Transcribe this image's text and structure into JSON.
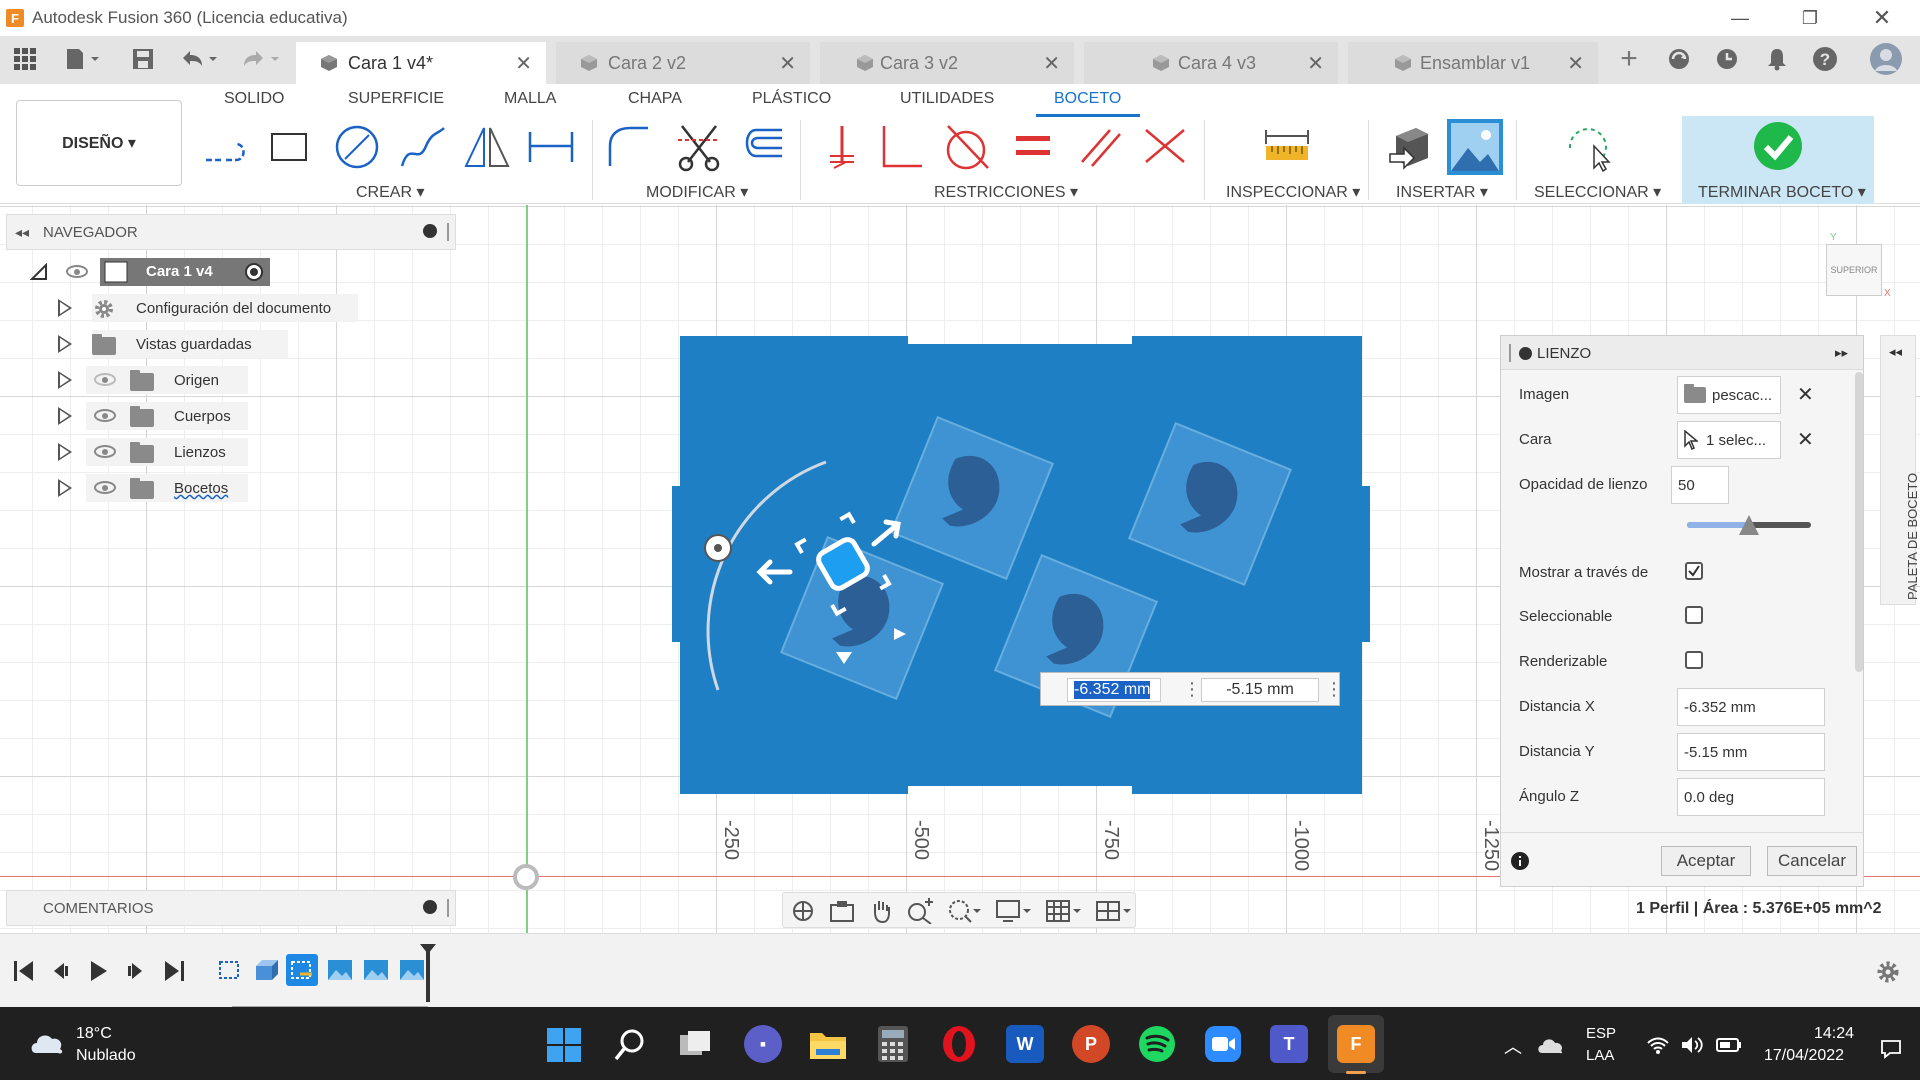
{
  "window": {
    "title": "Autodesk Fusion 360 (Licencia educativa)",
    "logo_letter": "F"
  },
  "tabs": [
    {
      "label": "Cara 1 v4*",
      "active": true
    },
    {
      "label": "Cara 2 v2",
      "active": false
    },
    {
      "label": "Cara 3 v2",
      "active": false
    },
    {
      "label": "Cara 4 v3",
      "active": false
    },
    {
      "label": "Ensamblar v1",
      "active": false
    }
  ],
  "workspace_tabs": [
    "SOLIDO",
    "SUPERFICIE",
    "MALLA",
    "CHAPA",
    "PLÁSTICO",
    "UTILIDADES",
    "BOCETO"
  ],
  "active_workspace_tab": "BOCETO",
  "design_button": "DISEÑO ▾",
  "ribbon_groups": {
    "crear": "CREAR ▾",
    "modificar": "MODIFICAR ▾",
    "restricciones": "RESTRICCIONES ▾",
    "inspeccionar": "INSPECCIONAR ▾",
    "insertar": "INSERTAR ▾",
    "seleccionar": "SELECCIONAR ▾",
    "terminar": "TERMINAR BOCETO ▾"
  },
  "navigator": {
    "title": "NAVEGADOR",
    "root": "Cara 1 v4",
    "items": [
      {
        "label": "Configuración del documento",
        "icon": "gear-icon"
      },
      {
        "label": "Vistas guardadas",
        "icon": "folder-icon"
      },
      {
        "label": "Origen",
        "icon": "folder-icon"
      },
      {
        "label": "Cuerpos",
        "icon": "folder-icon"
      },
      {
        "label": "Lienzos",
        "icon": "folder-icon"
      },
      {
        "label": "Bocetos",
        "icon": "folder-icon"
      }
    ]
  },
  "comments_label": "COMENTARIOS",
  "view_cube_label": "SUPERIOR",
  "ruler_labels": [
    "-250",
    "-500",
    "-750",
    "-1000",
    "-1250"
  ],
  "coordinate_input": {
    "x": "-6.352 mm",
    "y": "-5.15 mm"
  },
  "dialog": {
    "title": "LIENZO",
    "image_label": "Imagen",
    "image_value": "pescac...",
    "face_label": "Cara",
    "face_value": "1 selec...",
    "opacity_label": "Opacidad de lienzo",
    "opacity_value": "50",
    "opacity_level_percent": 50,
    "show_through_label": "Mostrar a través de",
    "show_through_checked": true,
    "selectable_label": "Seleccionable",
    "selectable_checked": false,
    "renderable_label": "Renderizable",
    "renderable_checked": false,
    "dist_x_label": "Distancia X",
    "dist_x_value": "-6.352 mm",
    "dist_y_label": "Distancia Y",
    "dist_y_value": "-5.15 mm",
    "angle_label": "Ángulo Z",
    "angle_value": "0.0 deg",
    "ok_label": "Aceptar",
    "cancel_label": "Cancelar"
  },
  "palette_label": "PALETA DE BOCETO",
  "status_text": "1 Perfil | Área : 5.376E+05 mm^2",
  "taskbar": {
    "weather_temp": "18°C",
    "weather_desc": "Nublado",
    "lang_1": "ESP",
    "lang_2": "LAA",
    "time": "14:24",
    "date": "17/04/2022"
  },
  "colors": {
    "accent": "#1a73c9",
    "sheet_blue": "#1e7fc4",
    "finish_green": "#1fb84a"
  }
}
